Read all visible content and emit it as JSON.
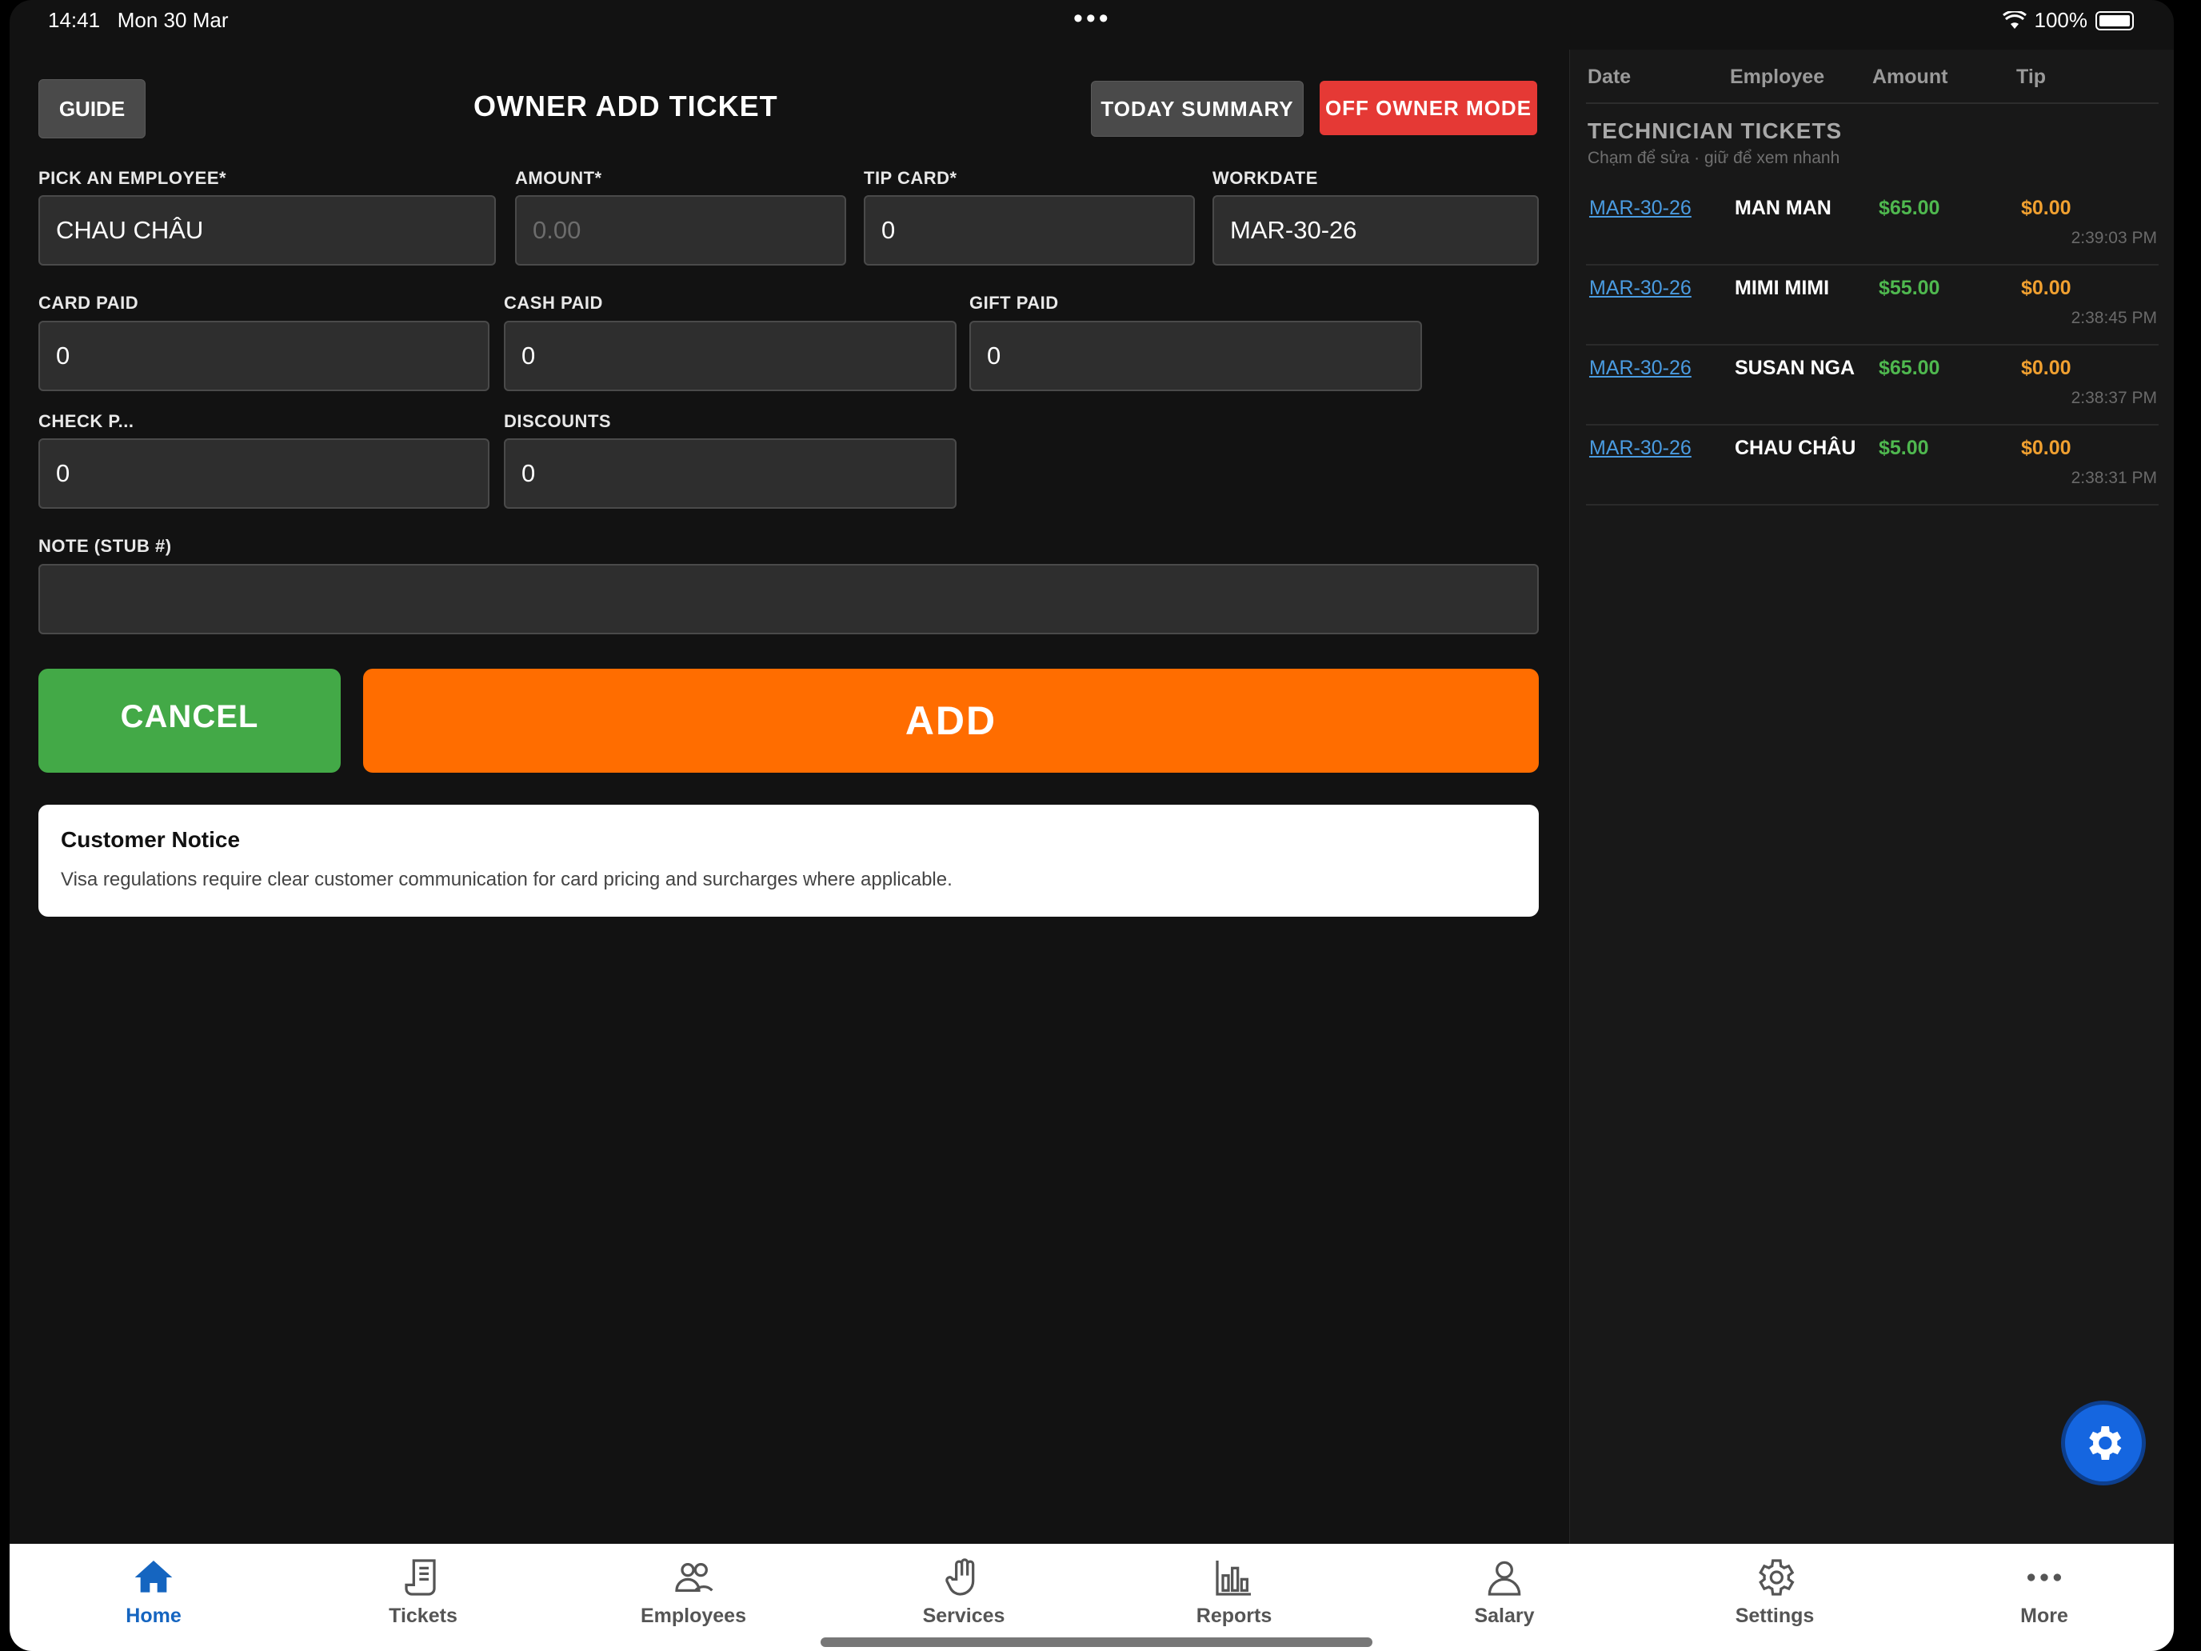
{
  "status_bar": {
    "time": "14:41",
    "date": "Mon 30 Mar",
    "battery": "100%"
  },
  "header": {
    "guide_label": "GUIDE",
    "title": "OWNER ADD TICKET",
    "today_summary_label": "TODAY SUMMARY",
    "off_owner_label": "OFF OWNER MODE"
  },
  "form": {
    "employee": {
      "label": "PICK AN EMPLOYEE*",
      "value": "CHAU CHÂU"
    },
    "amount": {
      "label": "AMOUNT*",
      "placeholder": "0.00"
    },
    "tip_card": {
      "label": "TIP CARD*",
      "value": "0"
    },
    "workdate": {
      "label": "WORKDATE",
      "value": "MAR-30-26"
    },
    "card_paid": {
      "label": "CARD PAID",
      "value": "0"
    },
    "cash_paid": {
      "label": "CASH PAID",
      "value": "0"
    },
    "gift_paid": {
      "label": "GIFT PAID",
      "value": "0"
    },
    "check_paid": {
      "label": "CHECK P...",
      "value": "0"
    },
    "discounts": {
      "label": "DISCOUNTS",
      "value": "0"
    },
    "note": {
      "label": "NOTE (STUB #)",
      "value": ""
    }
  },
  "actions": {
    "cancel_label": "CANCEL",
    "add_label": "ADD"
  },
  "notice": {
    "title": "Customer Notice",
    "text": "Visa regulations require clear customer communication for card pricing and surcharges where applicable."
  },
  "right_panel": {
    "columns": [
      "Date",
      "Employee",
      "Amount",
      "Tip"
    ],
    "title": "TECHNICIAN TICKETS",
    "subtitle": "Chạm để sửa · giữ để xem nhanh",
    "tickets": [
      {
        "date": "MAR-30-26",
        "employee": "MAN MAN",
        "amount": "$65.00",
        "tip": "$0.00",
        "time": "2:39:03 PM"
      },
      {
        "date": "MAR-30-26",
        "employee": "MIMI MIMI",
        "amount": "$55.00",
        "tip": "$0.00",
        "time": "2:38:45 PM"
      },
      {
        "date": "MAR-30-26",
        "employee": "SUSAN NGA",
        "amount": "$65.00",
        "tip": "$0.00",
        "time": "2:38:37 PM"
      },
      {
        "date": "MAR-30-26",
        "employee": "CHAU CHÂU",
        "amount": "$5.00",
        "tip": "$0.00",
        "time": "2:38:31 PM"
      }
    ]
  },
  "tabbar": {
    "tabs": [
      {
        "label": "Home",
        "icon": "home-icon",
        "active": true
      },
      {
        "label": "Tickets",
        "icon": "receipt-icon"
      },
      {
        "label": "Employees",
        "icon": "people-icon"
      },
      {
        "label": "Services",
        "icon": "hand-icon"
      },
      {
        "label": "Reports",
        "icon": "bar-chart-icon"
      },
      {
        "label": "Salary",
        "icon": "person-icon"
      },
      {
        "label": "Settings",
        "icon": "gear-icon"
      },
      {
        "label": "More",
        "icon": "more-icon"
      }
    ]
  },
  "colors": {
    "accent_orange": "#ff6d00",
    "cancel_green": "#43a947",
    "owner_red": "#e53935",
    "active_tab": "#1565c0"
  }
}
